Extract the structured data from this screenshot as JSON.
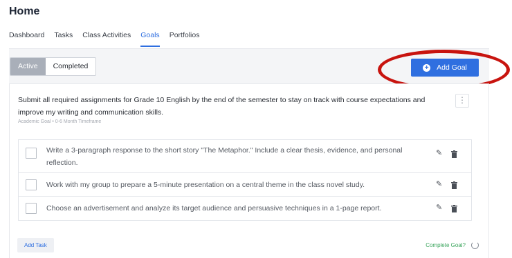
{
  "page": {
    "title": "Home"
  },
  "nav": {
    "tabs": [
      {
        "label": "Dashboard"
      },
      {
        "label": "Tasks"
      },
      {
        "label": "Class Activities"
      },
      {
        "label": "Goals",
        "active": true
      },
      {
        "label": "Portfolios"
      }
    ]
  },
  "filter": {
    "active_label": "Active",
    "completed_label": "Completed",
    "selected": "Active"
  },
  "toolbar": {
    "add_goal_label": "Add Goal",
    "add_goal_icon": "plus-circle-icon"
  },
  "goal": {
    "text": "Submit all required assignments for Grade 10 English by the end of the semester to stay on track with course expectations and improve my writing and communication skills.",
    "meta": "Academic Goal • 0-6 Month Timeframe",
    "tasks": [
      {
        "text": "Write a 3-paragraph response to the short story \"The Metaphor.\" Include a clear thesis, evidence, and personal reflection.",
        "done": false
      },
      {
        "text": "Work with my group to prepare a 5-minute presentation on a central theme in the class novel study.",
        "done": false
      },
      {
        "text": "Choose an advertisement and analyze its target audience and persuasive techniques in a 1-page report.",
        "done": false
      }
    ],
    "add_task_label": "Add Task",
    "complete_label": "Complete Goal?"
  },
  "colors": {
    "accent": "#2f6fe0",
    "highlight": "#c8140f",
    "complete": "#3aa55c",
    "active_segment": "#a9afb9"
  }
}
